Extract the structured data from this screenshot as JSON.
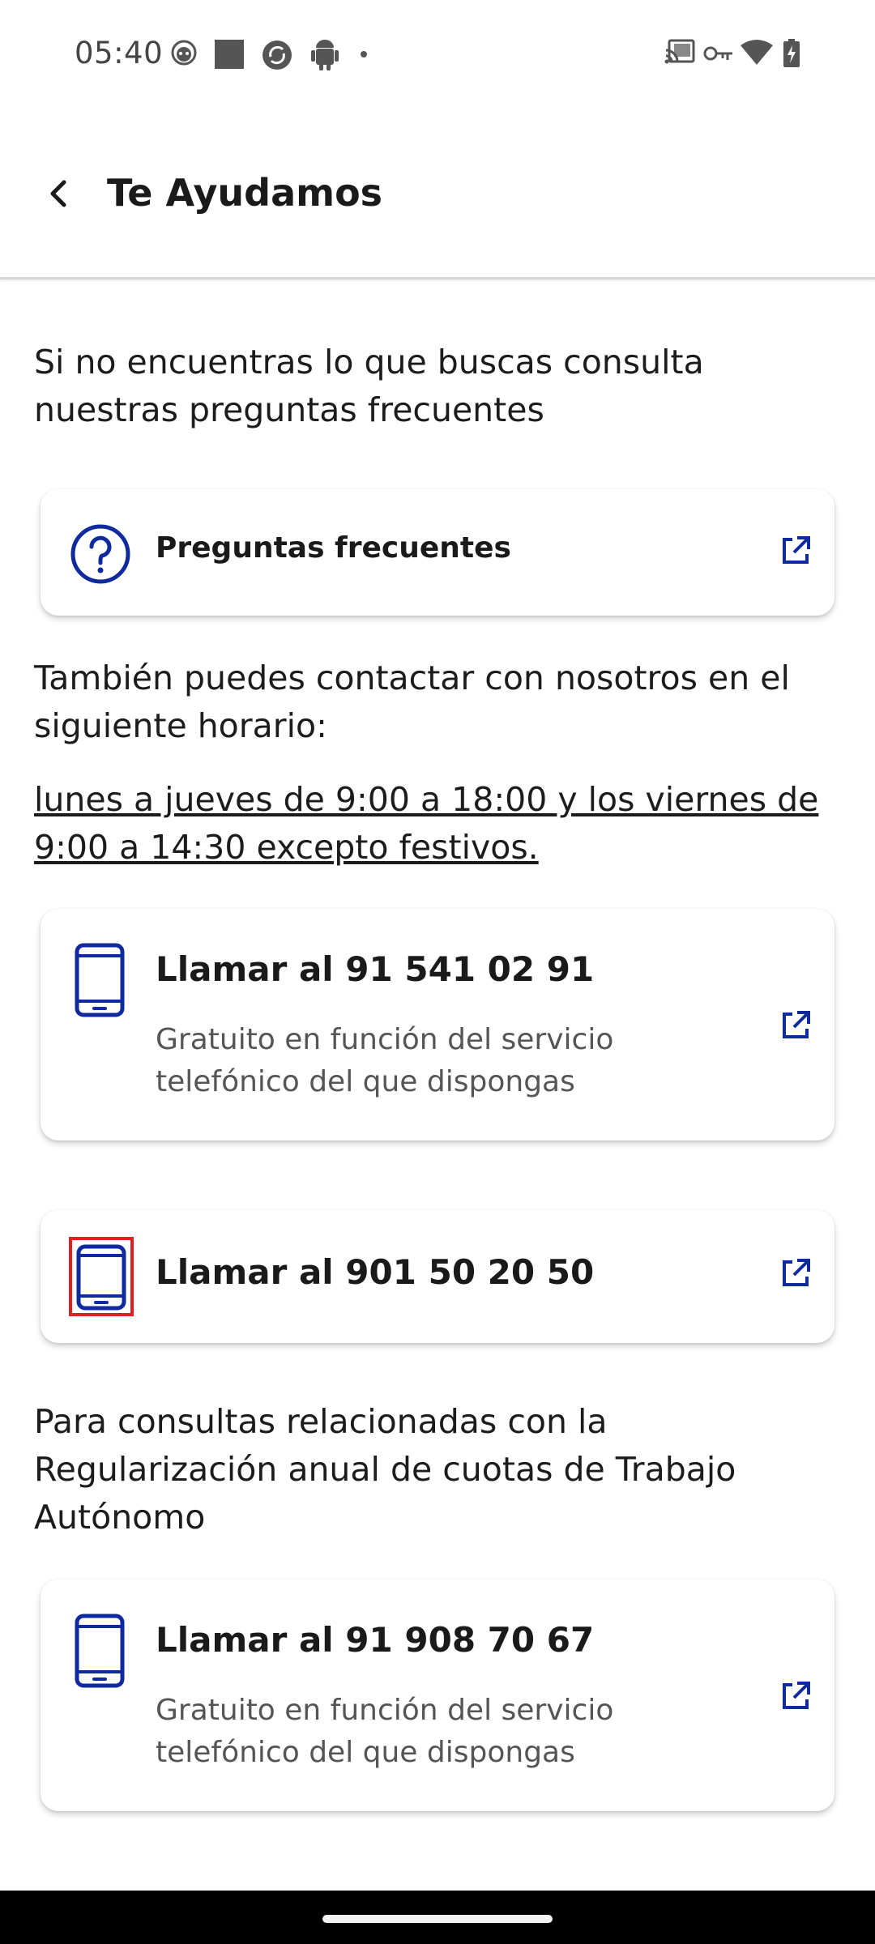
{
  "status_bar": {
    "time": "05:40",
    "left_icons": [
      "face-notification-icon",
      "square-notification-icon",
      "sync-notification-icon",
      "android-notification-icon",
      "dot-icon"
    ],
    "right_icons": [
      "cast-icon",
      "vpn-key-icon",
      "wifi-icon",
      "battery-charging-icon"
    ]
  },
  "app_bar": {
    "title": "Te Ayudamos",
    "back_icon": "back-arrow-icon"
  },
  "intro": "Si no encuentras lo que buscas consulta nuestras preguntas frecuentes",
  "faq_card": {
    "label": "Preguntas frecuentes",
    "icon": "question-circle-icon",
    "link_icon": "open-external-icon"
  },
  "contact_text": "También puedes contactar con nosotros en el siguiente horario:",
  "schedule_text": "lunes a jueves de 9:00 a 18:00 y los viernes de 9:00 a 14:30 excepto festivos.",
  "phone_cards": [
    {
      "title": "Llamar al 91 541 02 91",
      "subtitle": "Gratuito en función del servicio telefónico del que dispongas",
      "icon": "smartphone-icon",
      "link_icon": "open-external-icon"
    },
    {
      "title": "Llamar al 901 50 20 50",
      "subtitle": "",
      "icon": "smartphone-icon",
      "link_icon": "open-external-icon"
    },
    {
      "title": "Llamar al 91 908 70 67",
      "subtitle": "Gratuito en función del servicio telefónico del que dispongas",
      "icon": "smartphone-icon",
      "link_icon": "open-external-icon"
    }
  ],
  "regularization_text": "Para consultas relacionadas con la Regularización anual de cuotas de Trabajo Autónomo",
  "colors": {
    "accent": "#0f2a9c",
    "highlight": "#e02020",
    "text": "#1c1c1c",
    "subtext": "#555555"
  }
}
